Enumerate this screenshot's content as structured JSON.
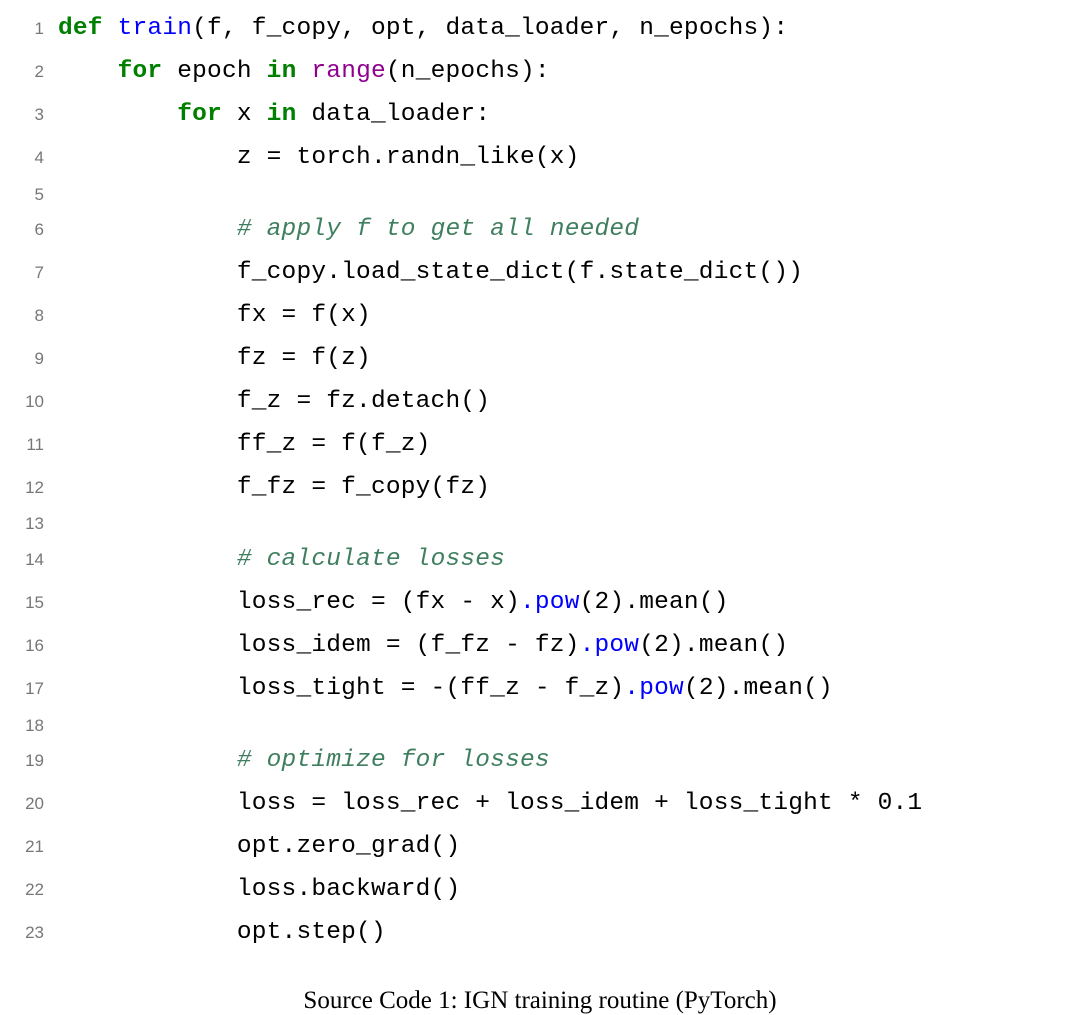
{
  "lines": [
    {
      "no": "1",
      "seg": [
        {
          "t": "def ",
          "c": "kw"
        },
        {
          "t": "train",
          "c": "fn"
        },
        {
          "t": "(f, f_copy, opt, data_loader, n_epochs):",
          "c": ""
        }
      ]
    },
    {
      "no": "2",
      "seg": [
        {
          "t": "    ",
          "c": ""
        },
        {
          "t": "for ",
          "c": "kw"
        },
        {
          "t": "epoch ",
          "c": ""
        },
        {
          "t": "in ",
          "c": "kw"
        },
        {
          "t": "range",
          "c": "bi"
        },
        {
          "t": "(n_epochs):",
          "c": ""
        }
      ]
    },
    {
      "no": "3",
      "seg": [
        {
          "t": "        ",
          "c": ""
        },
        {
          "t": "for ",
          "c": "kw"
        },
        {
          "t": "x ",
          "c": ""
        },
        {
          "t": "in ",
          "c": "kw"
        },
        {
          "t": "data_loader:",
          "c": ""
        }
      ]
    },
    {
      "no": "4",
      "seg": [
        {
          "t": "            z = torch.randn_like(x)",
          "c": ""
        }
      ]
    },
    {
      "no": "5",
      "seg": [
        {
          "t": "",
          "c": ""
        }
      ]
    },
    {
      "no": "6",
      "seg": [
        {
          "t": "            ",
          "c": ""
        },
        {
          "t": "# apply f to get all needed",
          "c": "cmt"
        }
      ]
    },
    {
      "no": "7",
      "seg": [
        {
          "t": "            f_copy.load_state_dict(f.state_dict())",
          "c": ""
        }
      ]
    },
    {
      "no": "8",
      "seg": [
        {
          "t": "            fx = f(x)",
          "c": ""
        }
      ]
    },
    {
      "no": "9",
      "seg": [
        {
          "t": "            fz = f(z)",
          "c": ""
        }
      ]
    },
    {
      "no": "10",
      "seg": [
        {
          "t": "            f_z = fz.detach()",
          "c": ""
        }
      ]
    },
    {
      "no": "11",
      "seg": [
        {
          "t": "            ff_z = f(f_z)",
          "c": ""
        }
      ]
    },
    {
      "no": "12",
      "seg": [
        {
          "t": "            f_fz = f_copy(fz)",
          "c": ""
        }
      ]
    },
    {
      "no": "13",
      "seg": [
        {
          "t": "",
          "c": ""
        }
      ]
    },
    {
      "no": "14",
      "seg": [
        {
          "t": "            ",
          "c": ""
        },
        {
          "t": "# calculate losses",
          "c": "cmt"
        }
      ]
    },
    {
      "no": "15",
      "seg": [
        {
          "t": "            loss_rec = (fx - x)",
          "c": ""
        },
        {
          "t": ".pow",
          "c": "mth"
        },
        {
          "t": "(2).mean()",
          "c": ""
        }
      ]
    },
    {
      "no": "16",
      "seg": [
        {
          "t": "            loss_idem = (f_fz - fz)",
          "c": ""
        },
        {
          "t": ".pow",
          "c": "mth"
        },
        {
          "t": "(2).mean()",
          "c": ""
        }
      ]
    },
    {
      "no": "17",
      "seg": [
        {
          "t": "            loss_tight = -(ff_z - f_z)",
          "c": ""
        },
        {
          "t": ".pow",
          "c": "mth"
        },
        {
          "t": "(2).mean()",
          "c": ""
        }
      ]
    },
    {
      "no": "18",
      "seg": [
        {
          "t": "",
          "c": ""
        }
      ]
    },
    {
      "no": "19",
      "seg": [
        {
          "t": "            ",
          "c": ""
        },
        {
          "t": "# optimize for losses",
          "c": "cmt"
        }
      ]
    },
    {
      "no": "20",
      "seg": [
        {
          "t": "            loss = loss_rec + loss_idem + loss_tight * 0.1",
          "c": ""
        }
      ]
    },
    {
      "no": "21",
      "seg": [
        {
          "t": "            opt.zero_grad()",
          "c": ""
        }
      ]
    },
    {
      "no": "22",
      "seg": [
        {
          "t": "            loss.backward()",
          "c": ""
        }
      ]
    },
    {
      "no": "23",
      "seg": [
        {
          "t": "            opt.step()",
          "c": ""
        }
      ]
    }
  ],
  "caption": "Source Code 1: IGN training routine (PyTorch)"
}
